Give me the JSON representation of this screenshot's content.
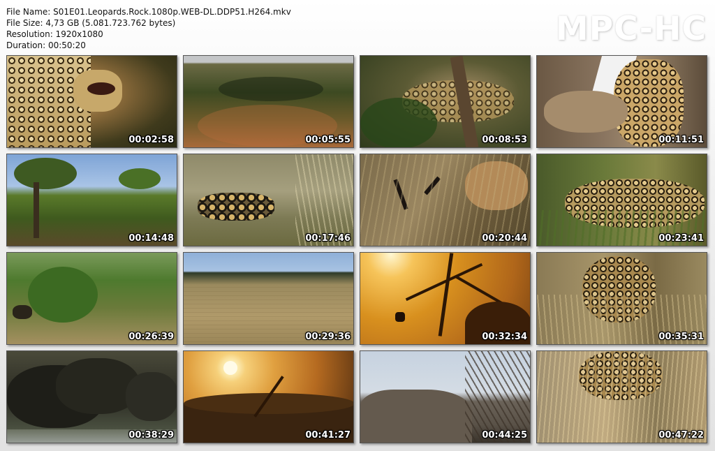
{
  "file_info": {
    "file_name": "File Name: S01E01.Leopards.Rock.1080p.WEB-DL.DDP51.H264.mkv",
    "file_size": "File Size: 4,73 GB (5.081.723.762 bytes)",
    "resolution": "Resolution: 1920x1080",
    "duration": "Duration: 00:50:20"
  },
  "logo": "MPC-HC",
  "thumbnails": [
    {
      "time": "00:02:58",
      "scene": "leopard-closeup"
    },
    {
      "time": "00:05:55",
      "scene": "aerial-landscape"
    },
    {
      "time": "00:08:53",
      "scene": "leopard-in-grass"
    },
    {
      "time": "00:11:51",
      "scene": "leopard-on-tree"
    },
    {
      "time": "00:14:48",
      "scene": "savanna-trees"
    },
    {
      "time": "00:17:46",
      "scene": "wild-dogs"
    },
    {
      "time": "00:20:44",
      "scene": "antelope-grass"
    },
    {
      "time": "00:23:41",
      "scene": "leopard-crouching"
    },
    {
      "time": "00:26:39",
      "scene": "bush-animal"
    },
    {
      "time": "00:29:36",
      "scene": "grassland-plain"
    },
    {
      "time": "00:32:34",
      "scene": "sunset-tree-silhouette"
    },
    {
      "time": "00:35:31",
      "scene": "leopard-walking"
    },
    {
      "time": "00:38:29",
      "scene": "buffalo-herd"
    },
    {
      "time": "00:41:27",
      "scene": "sunset-horizon"
    },
    {
      "time": "00:44:25",
      "scene": "rocks-branches"
    },
    {
      "time": "00:47:22",
      "scene": "leopard-in-brush"
    }
  ]
}
